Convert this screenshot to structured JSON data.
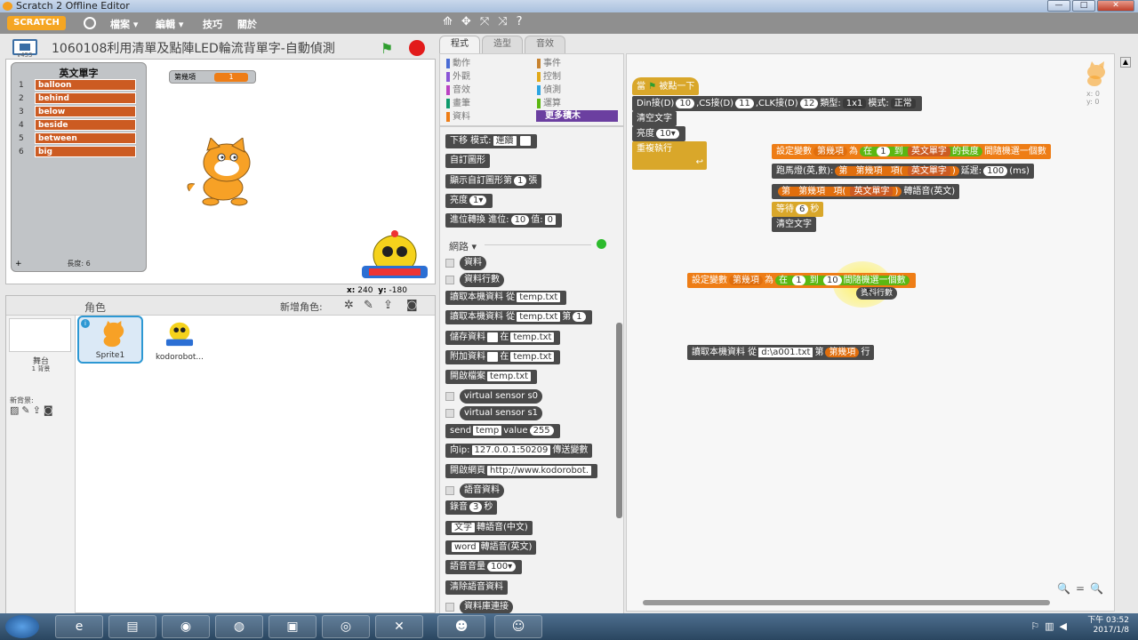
{
  "window": {
    "title": "Scratch 2 Offline Editor",
    "min": "—",
    "max": "□",
    "close": "✕"
  },
  "menu": {
    "logo": "SCRATCH",
    "items": [
      "檔案 ▾",
      "編輯 ▾",
      "技巧",
      "關於"
    ]
  },
  "toolbar_icons": [
    "⟰",
    "✥",
    "⤧",
    "⤨",
    "?"
  ],
  "stage": {
    "version": "v453",
    "project_title": "1060108利用清單及點陣LED輪流背單字-自動偵測",
    "list_title": "英文單字",
    "list_items": [
      {
        "i": "1",
        "v": "balloon"
      },
      {
        "i": "2",
        "v": "behind"
      },
      {
        "i": "3",
        "v": "below"
      },
      {
        "i": "4",
        "v": "beside"
      },
      {
        "i": "5",
        "v": "between"
      },
      {
        "i": "6",
        "v": "big"
      }
    ],
    "list_length": "長度: 6",
    "list_add": "+",
    "var_name": "第幾項",
    "var_value": "1",
    "x_label": "x:",
    "x_value": "240",
    "y_label": "y:",
    "y_value": "-180"
  },
  "sprites": {
    "header": "角色",
    "new_sprite": "新增角色:",
    "stage_label": "舞台",
    "stage_backdrops": "1 背景",
    "new_backdrop": "新背景:",
    "items": [
      {
        "name": "Sprite1"
      },
      {
        "name": "kodorobot..."
      }
    ]
  },
  "tabs": [
    "程式",
    "造型",
    "音效"
  ],
  "categories": [
    {
      "label": "動作",
      "color": "#4a6cd4"
    },
    {
      "label": "事件",
      "color": "#c88330"
    },
    {
      "label": "外觀",
      "color": "#8a55d7"
    },
    {
      "label": "控制",
      "color": "#e1a91a"
    },
    {
      "label": "音效",
      "color": "#bb42c3"
    },
    {
      "label": "偵測",
      "color": "#2ca5e2"
    },
    {
      "label": "畫筆",
      "color": "#0e9a6c"
    },
    {
      "label": "運算",
      "color": "#5cb712"
    },
    {
      "label": "資料",
      "color": "#ee7d16"
    },
    {
      "label": "更多積木",
      "color": "#632d99"
    }
  ],
  "palette": {
    "b1a": "下移 模式:",
    "b1b": "連續",
    "b2": "自訂圖形",
    "b3a": "顯示自訂圖形第",
    "b3b": "1",
    "b3c": "張",
    "b4a": "亮度",
    "b4b": "1▾",
    "b5a": "進位轉換 進位:",
    "b5b": "10",
    "b5c": "值:",
    "b5d": "0",
    "net": "網路 ▾",
    "r1": "資料",
    "r2": "資料行數",
    "b6a": "讀取本機資料 從",
    "b6b": "temp.txt",
    "b7a": "讀取本機資料 從",
    "b7b": "temp.txt",
    "b7c": "第",
    "b7d": "1",
    "b8a": "儲存資料",
    "b8b": "在",
    "b8c": "temp.txt",
    "b9a": "附加資料",
    "b9b": "在",
    "b9c": "temp.txt",
    "b10a": "開啟檔案",
    "b10b": "temp.txt",
    "r3": "virtual sensor s0",
    "r4": "virtual sensor s1",
    "b11a": "send",
    "b11b": "temp",
    "b11c": "value",
    "b11d": "255",
    "b12a": "向ip:",
    "b12b": "127.0.0.1:50209",
    "b12c": "傳送變數",
    "b13a": "開啟網頁",
    "b13b": "http://www.kodorobot.",
    "r5": "語音資料",
    "b14a": "錄音",
    "b14b": "3",
    "b14c": "秒",
    "b15a": "文字",
    "b15b": "轉語音(中文)",
    "b16a": "word",
    "b16b": "轉語音(英文)",
    "b17a": "語音音量",
    "b17b": "100▾",
    "b18": "清除語音資料",
    "r6": "資料庫連接"
  },
  "scripts": {
    "hat_a": "當",
    "hat_b": "被點一下",
    "s1a": "Din接(D)",
    "s1b": "10",
    "s1c": ",CS接(D)",
    "s1d": "11",
    "s1e": ",CLK接(D)",
    "s1f": "12",
    "s1g": "類型:",
    "s1h": "1x1",
    "s1i": "模式:",
    "s1j": "正常",
    "s2": "清空文字",
    "s3a": "亮度",
    "s3b": "10▾",
    "s4": "重複執行",
    "c1a": "設定變數",
    "c1b": "第幾項",
    "c1c": "為",
    "c1d": "在",
    "c1e": "1",
    "c1f": "到",
    "c1g": "英文單字",
    "c1h": "的長度",
    "c1i": "間隨機選一個數",
    "c2a": "跑馬燈(英,數):",
    "c2b": "第",
    "c2c": "第幾項",
    "c2d": "項(",
    "c2e": "英文單字",
    "c2f": ")",
    "c2g": "延遲:",
    "c2h": "100",
    "c2i": "(ms)",
    "c3a": "第",
    "c3b": "第幾項",
    "c3c": "項(",
    "c3d": "英文單字",
    "c3e": ")",
    "c3f": "轉語音(英文)",
    "c4a": "等待",
    "c4b": "6",
    "c4c": "秒",
    "c5": "清空文字",
    "d1a": "設定變數",
    "d1b": "第幾項",
    "d1c": "為",
    "d1d": "在",
    "d1e": "1",
    "d1f": "到",
    "d1g": "10",
    "d1h": "間隨機選一個數",
    "d1i": "資料行數",
    "e1a": "讀取本機資料 從",
    "e1b": "d:\\a001.txt",
    "e1c": "第",
    "e1d": "第幾項",
    "e1e": "行",
    "sprite_x": "x: 0",
    "sprite_y": "y: 0",
    "zoom_out": "🔍",
    "zoom_reset": "=",
    "zoom_in": "🔍"
  },
  "taskbar": {
    "time": "下午 03:52",
    "date": "2017/1/8"
  }
}
